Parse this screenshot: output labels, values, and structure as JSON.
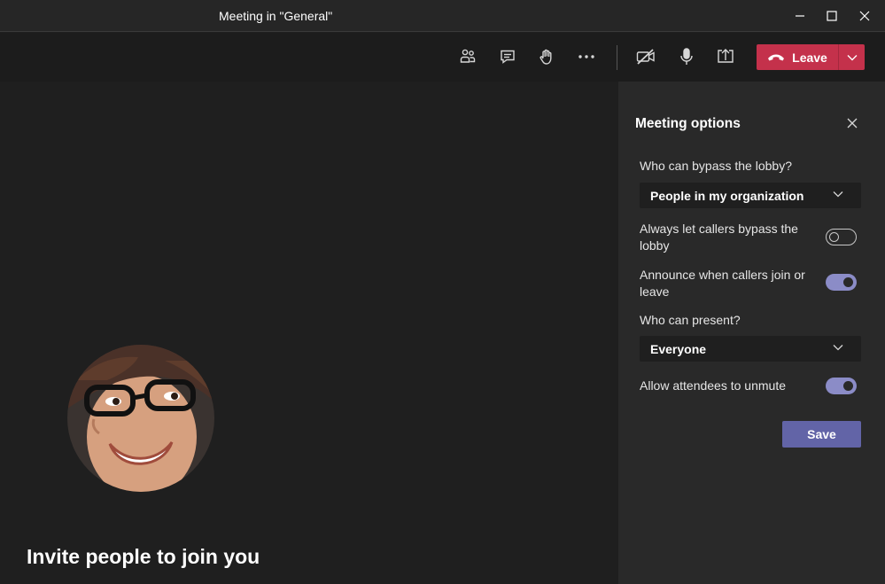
{
  "window": {
    "title": "Meeting in \"General\""
  },
  "toolbar": {
    "icons": [
      "participants-icon",
      "chat-icon",
      "raise-hand-icon",
      "more-icon",
      "camera-off-icon",
      "microphone-icon",
      "share-screen-icon"
    ],
    "leave_label": "Leave",
    "leave_color": "#c4314b"
  },
  "stage": {
    "invite_text": "Invite people to join you"
  },
  "panel": {
    "title": "Meeting options",
    "bypass_label": "Who can bypass the lobby?",
    "bypass_value": "People in my organization",
    "callers_bypass_label": "Always let callers bypass the lobby",
    "callers_bypass_on": false,
    "announce_label": "Announce when callers join or leave",
    "announce_on": true,
    "present_label": "Who can present?",
    "present_value": "Everyone",
    "unmute_label": "Allow attendees to unmute",
    "unmute_on": true,
    "save_label": "Save",
    "accent": "#6264a7"
  }
}
